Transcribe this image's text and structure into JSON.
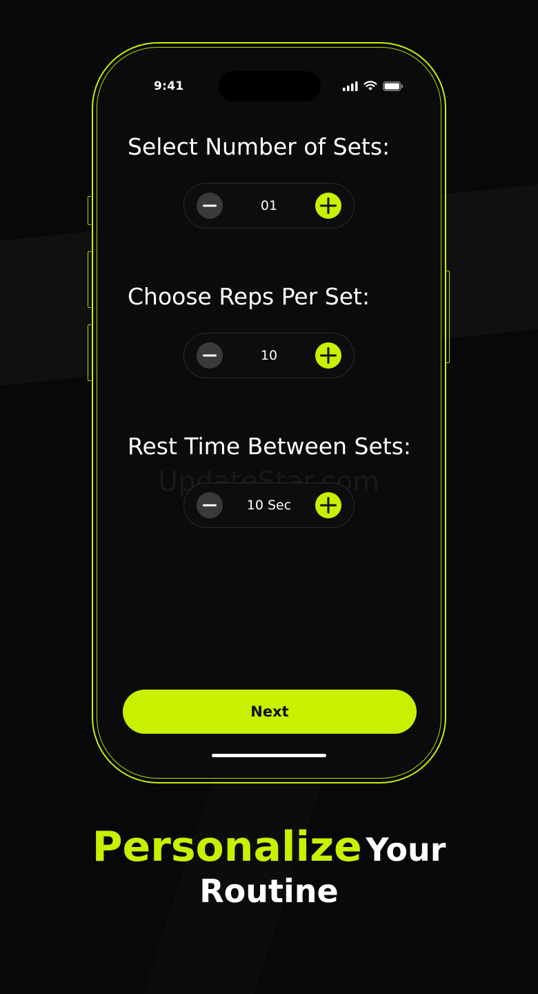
{
  "status_bar": {
    "time": "9:41"
  },
  "sections": [
    {
      "title": "Select Number of Sets:",
      "value": "01"
    },
    {
      "title": "Choose Reps Per Set:",
      "value": "10"
    },
    {
      "title": "Rest Time Between Sets:",
      "value": "10 Sec"
    }
  ],
  "watermark": "UpdateStar.com",
  "next_label": "Next",
  "headline": {
    "accent": "Personalize",
    "rest": "Your",
    "line2": "Routine"
  },
  "colors": {
    "accent": "#c8f001",
    "background": "#080808",
    "minus_button": "#3a3a3a"
  },
  "icons": [
    "minus-icon",
    "plus-icon",
    "signal-icon",
    "wifi-icon",
    "battery-icon"
  ]
}
